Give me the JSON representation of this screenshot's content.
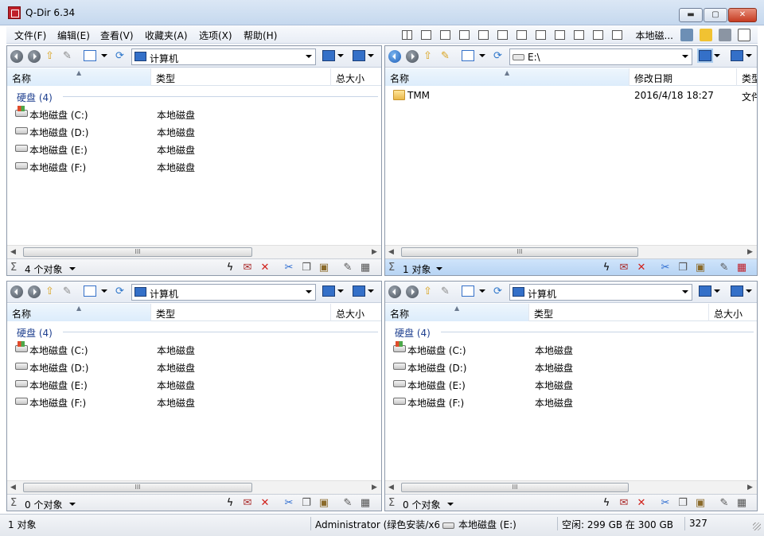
{
  "window": {
    "title": "Q-Dir 6.34",
    "min_label": "▬",
    "max_label": "▢",
    "close_label": "✕"
  },
  "menu": [
    "文件(F)",
    "编辑(E)",
    "查看(V)",
    "收藏夹(A)",
    "选项(X)",
    "帮助(H)"
  ],
  "menu_tools": {
    "drive_label": "本地磁..."
  },
  "panes": {
    "tl": {
      "address": "计算机",
      "columns": [
        "名称",
        "类型",
        "总大小"
      ],
      "group": "硬盘 (4)",
      "rows": [
        {
          "name": "本地磁盘 (C:)",
          "type": "本地磁盘"
        },
        {
          "name": "本地磁盘 (D:)",
          "type": "本地磁盘"
        },
        {
          "name": "本地磁盘 (E:)",
          "type": "本地磁盘"
        },
        {
          "name": "本地磁盘 (F:)",
          "type": "本地磁盘"
        }
      ],
      "status": "4 个对象"
    },
    "tr": {
      "address": "E:\\",
      "columns": [
        "名称",
        "修改日期",
        "类型"
      ],
      "rows": [
        {
          "name": "TMM",
          "date": "2016/4/18 18:27",
          "type": "文件"
        }
      ],
      "status": "1 对象"
    },
    "bl": {
      "address": "计算机",
      "columns": [
        "名称",
        "类型",
        "总大小"
      ],
      "group": "硬盘 (4)",
      "rows": [
        {
          "name": "本地磁盘 (C:)",
          "type": "本地磁盘"
        },
        {
          "name": "本地磁盘 (D:)",
          "type": "本地磁盘"
        },
        {
          "name": "本地磁盘 (E:)",
          "type": "本地磁盘"
        },
        {
          "name": "本地磁盘 (F:)",
          "type": "本地磁盘"
        }
      ],
      "status": "0 个对象"
    },
    "br": {
      "address": "计算机",
      "columns": [
        "名称",
        "类型",
        "总大小"
      ],
      "group": "硬盘 (4)",
      "rows": [
        {
          "name": "本地磁盘 (C:)",
          "type": "本地磁盘"
        },
        {
          "name": "本地磁盘 (D:)",
          "type": "本地磁盘"
        },
        {
          "name": "本地磁盘 (E:)",
          "type": "本地磁盘"
        },
        {
          "name": "本地磁盘 (F:)",
          "type": "本地磁盘"
        }
      ],
      "status": "0 个对象"
    }
  },
  "scroll_thumb": "III",
  "main_status": {
    "objects": "1 对象",
    "user": "Administrator (绿色安装/x64",
    "drive": "本地磁盘 (E:)",
    "free": "空闲: 299 GB 在 300 GB",
    "count": "327"
  },
  "colors": {
    "accent": "#1e3f8f",
    "active_status": "#b6d3f3"
  }
}
